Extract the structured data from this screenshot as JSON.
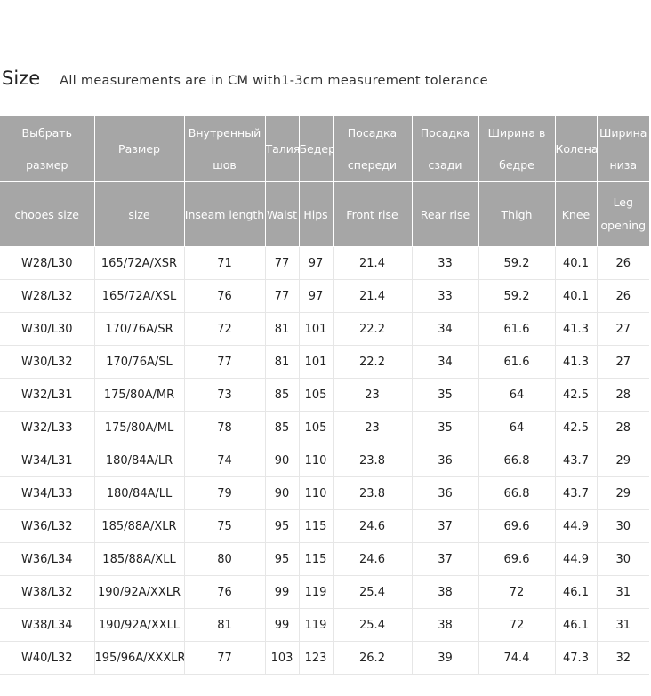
{
  "header": {
    "title": "Size",
    "note": "All measurements are in CM with1-3cm measurement tolerance"
  },
  "table": {
    "columns_ru": [
      "Выбрать размер",
      "Размер",
      "Внутренный шов",
      "Талия",
      "Бедер",
      "Посадка спереди",
      "Посадка сзади",
      "Ширина в бедре",
      "Колена",
      "Ширина низа"
    ],
    "columns_en": [
      "chooes size",
      "size",
      "Inseam length",
      "Waist",
      "Hips",
      "Front rise",
      "Rear rise",
      "Thigh",
      "Knee",
      "Leg opening"
    ],
    "rows": [
      [
        "W28/L30",
        "165/72A/XSR",
        "71",
        "77",
        "97",
        "21.4",
        "33",
        "59.2",
        "40.1",
        "26"
      ],
      [
        "W28/L32",
        "165/72A/XSL",
        "76",
        "77",
        "97",
        "21.4",
        "33",
        "59.2",
        "40.1",
        "26"
      ],
      [
        "W30/L30",
        "170/76A/SR",
        "72",
        "81",
        "101",
        "22.2",
        "34",
        "61.6",
        "41.3",
        "27"
      ],
      [
        "W30/L32",
        "170/76A/SL",
        "77",
        "81",
        "101",
        "22.2",
        "34",
        "61.6",
        "41.3",
        "27"
      ],
      [
        "W32/L31",
        "175/80A/MR",
        "73",
        "85",
        "105",
        "23",
        "35",
        "64",
        "42.5",
        "28"
      ],
      [
        "W32/L33",
        "175/80A/ML",
        "78",
        "85",
        "105",
        "23",
        "35",
        "64",
        "42.5",
        "28"
      ],
      [
        "W34/L31",
        "180/84A/LR",
        "74",
        "90",
        "110",
        "23.8",
        "36",
        "66.8",
        "43.7",
        "29"
      ],
      [
        "W34/L33",
        "180/84A/LL",
        "79",
        "90",
        "110",
        "23.8",
        "36",
        "66.8",
        "43.7",
        "29"
      ],
      [
        "W36/L32",
        "185/88A/XLR",
        "75",
        "95",
        "115",
        "24.6",
        "37",
        "69.6",
        "44.9",
        "30"
      ],
      [
        "W36/L34",
        "185/88A/XLL",
        "80",
        "95",
        "115",
        "24.6",
        "37",
        "69.6",
        "44.9",
        "30"
      ],
      [
        "W38/L32",
        "190/92A/XXLR",
        "76",
        "99",
        "119",
        "25.4",
        "38",
        "72",
        "46.1",
        "31"
      ],
      [
        "W38/L34",
        "190/92A/XXLL",
        "81",
        "99",
        "119",
        "25.4",
        "38",
        "72",
        "46.1",
        "31"
      ],
      [
        "W40/L32",
        "195/96A/XXXLR",
        "77",
        "103",
        "123",
        "26.2",
        "39",
        "74.4",
        "47.3",
        "32"
      ]
    ]
  },
  "colors": {
    "header_bg": "#a6a6a6",
    "header_text": "#ffffff",
    "grid_line": "#e6e6e6"
  }
}
